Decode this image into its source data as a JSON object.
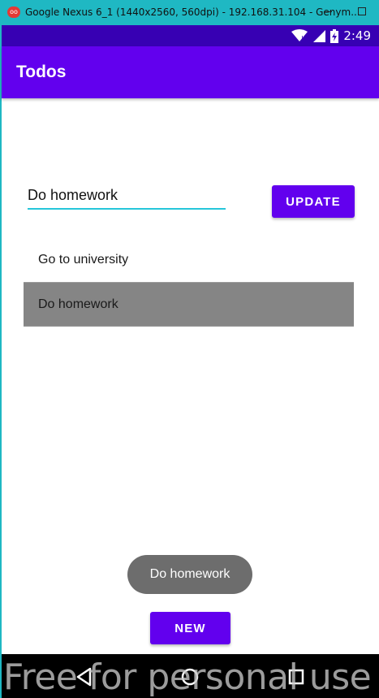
{
  "window": {
    "title": "Google Nexus 6_1 (1440x2560, 560dpi) - 192.168.31.104 - Genym...",
    "icon": "genymotion-icon",
    "icon_glyph": "oo"
  },
  "status_bar": {
    "time": "2:49",
    "icons": [
      "wifi-icon",
      "cell-signal-icon",
      "battery-charging-icon"
    ]
  },
  "app_bar": {
    "title": "Todos"
  },
  "editor": {
    "value": "Do homework",
    "update_label": "UPDATE"
  },
  "todos": [
    {
      "label": "Go to university",
      "selected": false
    },
    {
      "label": "Do homework",
      "selected": true
    }
  ],
  "toast": {
    "text": "Do homework"
  },
  "new_button": {
    "label": "NEW"
  },
  "nav_bar": {
    "buttons": [
      "back-icon",
      "home-icon",
      "recents-icon"
    ]
  },
  "watermark": {
    "text": "Free for personal use"
  },
  "colors": {
    "window_chrome": "#1fb8c3",
    "status_bar": "#3700b3",
    "primary": "#6200ee",
    "accent_underline": "#26c6da",
    "selected_row": "#858585",
    "toast": "#6d6d6d"
  }
}
